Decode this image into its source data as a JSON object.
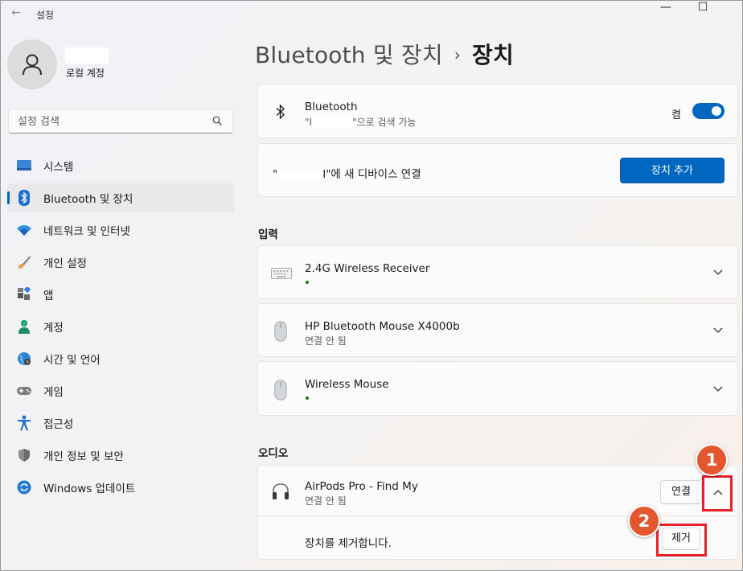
{
  "app": {
    "title": "설정",
    "back_glyph": "←"
  },
  "window": {
    "min_glyph": "—",
    "max_glyph": "☐"
  },
  "profile": {
    "account_type": "로컬 계정"
  },
  "search": {
    "placeholder": "설정 검색"
  },
  "nav": {
    "items": [
      {
        "label": "시스템",
        "icon": "system-icon"
      },
      {
        "label": "Bluetooth 및 장치",
        "icon": "bluetooth-icon",
        "active": true
      },
      {
        "label": "네트워크 및 인터넷",
        "icon": "wifi-icon"
      },
      {
        "label": "개인 설정",
        "icon": "brush-icon"
      },
      {
        "label": "앱",
        "icon": "apps-icon"
      },
      {
        "label": "계정",
        "icon": "account-icon"
      },
      {
        "label": "시간 및 언어",
        "icon": "globe-icon"
      },
      {
        "label": "게임",
        "icon": "gamepad-icon"
      },
      {
        "label": "접근성",
        "icon": "accessibility-icon"
      },
      {
        "label": "개인 정보 및 보안",
        "icon": "shield-icon"
      },
      {
        "label": "Windows 업데이트",
        "icon": "update-icon"
      }
    ]
  },
  "header": {
    "breadcrumb": "Bluetooth 및 장치",
    "separator": "›",
    "current": "장치"
  },
  "bluetooth": {
    "title": "Bluetooth",
    "status_prefix": "\"I",
    "status_suffix": "\"으로 검색 가능",
    "toggle_label": "켬",
    "toggle_on": true
  },
  "add_device": {
    "text_prefix": "\"",
    "text_suffix": "I\"에 새 디바이스 연결",
    "button": "장치 추가"
  },
  "input_section": {
    "title": "입력",
    "devices": [
      {
        "name": "2.4G Wireless Receiver",
        "status": "",
        "icon": "keyboard-icon",
        "connected": true
      },
      {
        "name": "HP Bluetooth Mouse X4000b",
        "status": "연결 안 됨",
        "icon": "mouse-icon",
        "connected": false
      },
      {
        "name": "Wireless Mouse",
        "status": "",
        "icon": "mouse-icon",
        "connected": true
      }
    ]
  },
  "audio_section": {
    "title": "오디오",
    "device": {
      "name": "AirPods Pro - Find My",
      "status": "연결 안 됨",
      "icon": "headphones-icon",
      "connect_button": "연결"
    },
    "remove_text": "장치를 제거합니다.",
    "remove_button": "제거"
  },
  "annotations": {
    "badge1": "1",
    "badge2": "2"
  },
  "colors": {
    "accent": "#0067c0",
    "callout": "#e8202a",
    "badge": "#e4572e",
    "connected_dot": "#0f7b0f"
  }
}
